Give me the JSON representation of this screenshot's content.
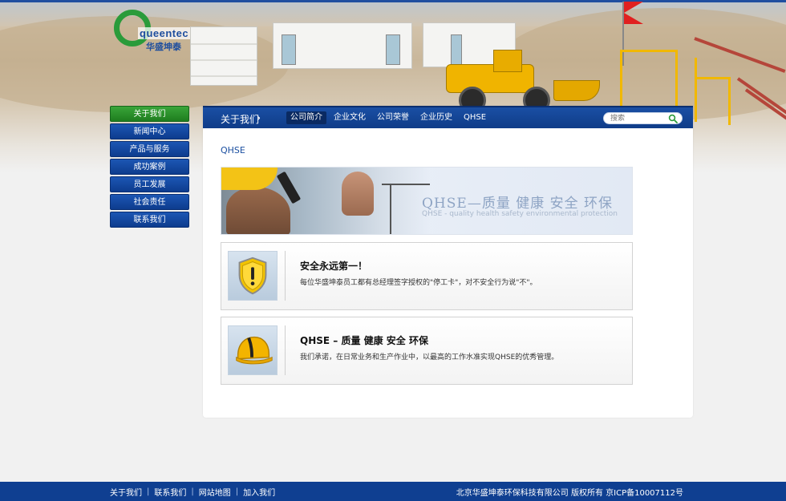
{
  "logo": {
    "word": "queentec",
    "cn": "华盛坤泰"
  },
  "sidebar": {
    "items": [
      {
        "label": "关于我们",
        "active": true
      },
      {
        "label": "新闻中心",
        "active": false
      },
      {
        "label": "产品与服务",
        "active": false
      },
      {
        "label": "成功案例",
        "active": false
      },
      {
        "label": "员工发展",
        "active": false
      },
      {
        "label": "社会责任",
        "active": false
      },
      {
        "label": "联系我们",
        "active": false
      }
    ]
  },
  "nav": {
    "section": "关于我们",
    "chevron": "›",
    "tabs": [
      {
        "label": "公司简介",
        "active": true
      },
      {
        "label": "企业文化",
        "active": false
      },
      {
        "label": "公司荣誉",
        "active": false
      },
      {
        "label": "企业历史",
        "active": false
      },
      {
        "label": "QHSE",
        "active": false
      }
    ],
    "search_placeholder": "搜索"
  },
  "main": {
    "title": "QHSE",
    "banner": {
      "title": "QHSE—质量 健康 安全 环保",
      "subtitle": "QHSE - quality health safety environmental protection"
    },
    "cards": [
      {
        "icon": "shield-warning-icon",
        "title": "安全永远第一！",
        "text": "每位华盛坤泰员工都有总经理签字授权的\"停工卡\"，对不安全行为说\"不\"。"
      },
      {
        "icon": "hardhat-icon",
        "title": "QHSE – 质量 健康 安全 环保",
        "text": "我们承诺，在日常业务和生产作业中，以最高的工作水准实现QHSE的优秀管理。"
      }
    ]
  },
  "footer": {
    "links": [
      "关于我们",
      "联系我们",
      "网站地图",
      "加入我们"
    ],
    "separator": "|",
    "copyright": "北京华盛坤泰环保科技有限公司 版权所有 京ICP备10007112号"
  },
  "colors": {
    "brand_blue": "#0f3f91",
    "brand_green": "#2a9b3a",
    "accent_yellow": "#f0b400"
  }
}
